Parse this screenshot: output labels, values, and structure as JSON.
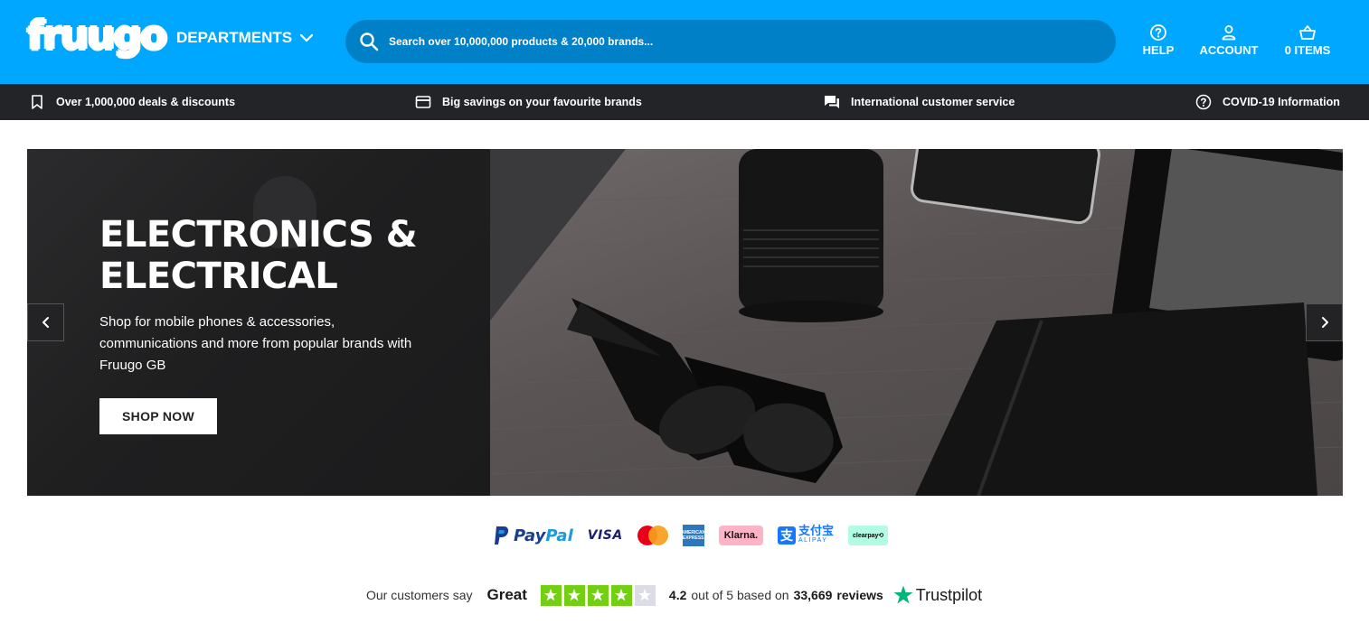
{
  "header": {
    "logo_text": "fruugo",
    "departments_label": "DEPARTMENTS",
    "search_placeholder": "Search over 10,000,000 products & 20,000 brands...",
    "help_label": "HELP",
    "account_label": "ACCOUNT",
    "items_label": "0 ITEMS",
    "bg_color": "#00a7ff"
  },
  "infobar": {
    "items": [
      {
        "label": "Over 1,000,000 deals & discounts",
        "icon": "bookmark-icon"
      },
      {
        "label": "Big savings on your favourite brands",
        "icon": "card-icon"
      },
      {
        "label": "International customer service",
        "icon": "chat-icon"
      },
      {
        "label": "COVID-19 Information",
        "icon": "help-circle-icon"
      }
    ]
  },
  "hero": {
    "title": "ELECTRONICS & ELECTRICAL",
    "description": "Shop for mobile phones & accessories, communications and more from popular brands with Fruugo GB",
    "cta_label": "SHOP NOW"
  },
  "payments": {
    "paypal_a": "Pay",
    "paypal_b": "Pal",
    "visa": "VISA",
    "amex": "AMERICAN EXPRESS",
    "klarna": "Klarna.",
    "alipay_cn": "支付宝",
    "alipay_en": "ALIPAY",
    "clearpay": "clearpay⟲"
  },
  "trustpilot": {
    "intro": "Our customers say",
    "rating_word": "Great",
    "stars_filled": 4,
    "stars_total": 5,
    "score": "4.2",
    "out_of_text": "out of 5 based on",
    "review_count": "33,669",
    "reviews_word": "reviews",
    "brand": "Trustpilot"
  }
}
